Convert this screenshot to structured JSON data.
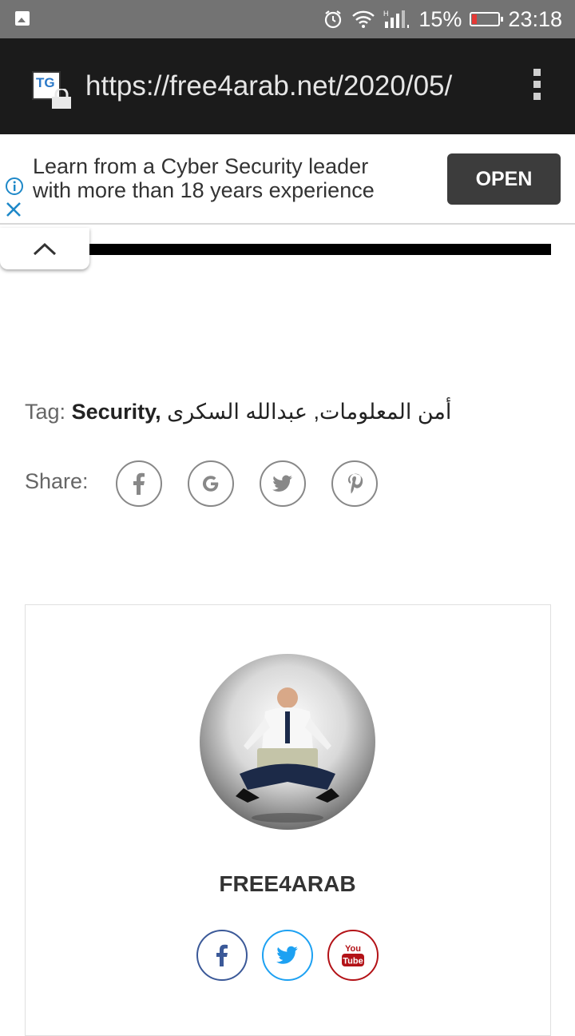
{
  "status_bar": {
    "battery": "15%",
    "time": "23:18",
    "network": "H"
  },
  "browser": {
    "url": "https://free4arab.net/2020/05/",
    "favicon_text": "TG"
  },
  "ad": {
    "line1": "Learn from a Cyber Security leader",
    "line2": "with more than 18 years experience",
    "cta": "OPEN"
  },
  "tags": {
    "label": "Tag:",
    "items": [
      "Security,",
      "أمن المعلومات, عبدالله السكرى"
    ]
  },
  "share": {
    "label": "Share:",
    "buttons": [
      "facebook-icon",
      "google-icon",
      "twitter-icon",
      "pinterest-icon"
    ]
  },
  "author": {
    "name": "FREE4ARAB",
    "socials": [
      "facebook-icon",
      "twitter-icon",
      "youtube-icon"
    ],
    "youtube_text_top": "You",
    "youtube_text_bottom": "Tube"
  },
  "colors": {
    "facebook": "#3b5998",
    "twitter": "#1da1f2",
    "youtube": "#b31217"
  }
}
